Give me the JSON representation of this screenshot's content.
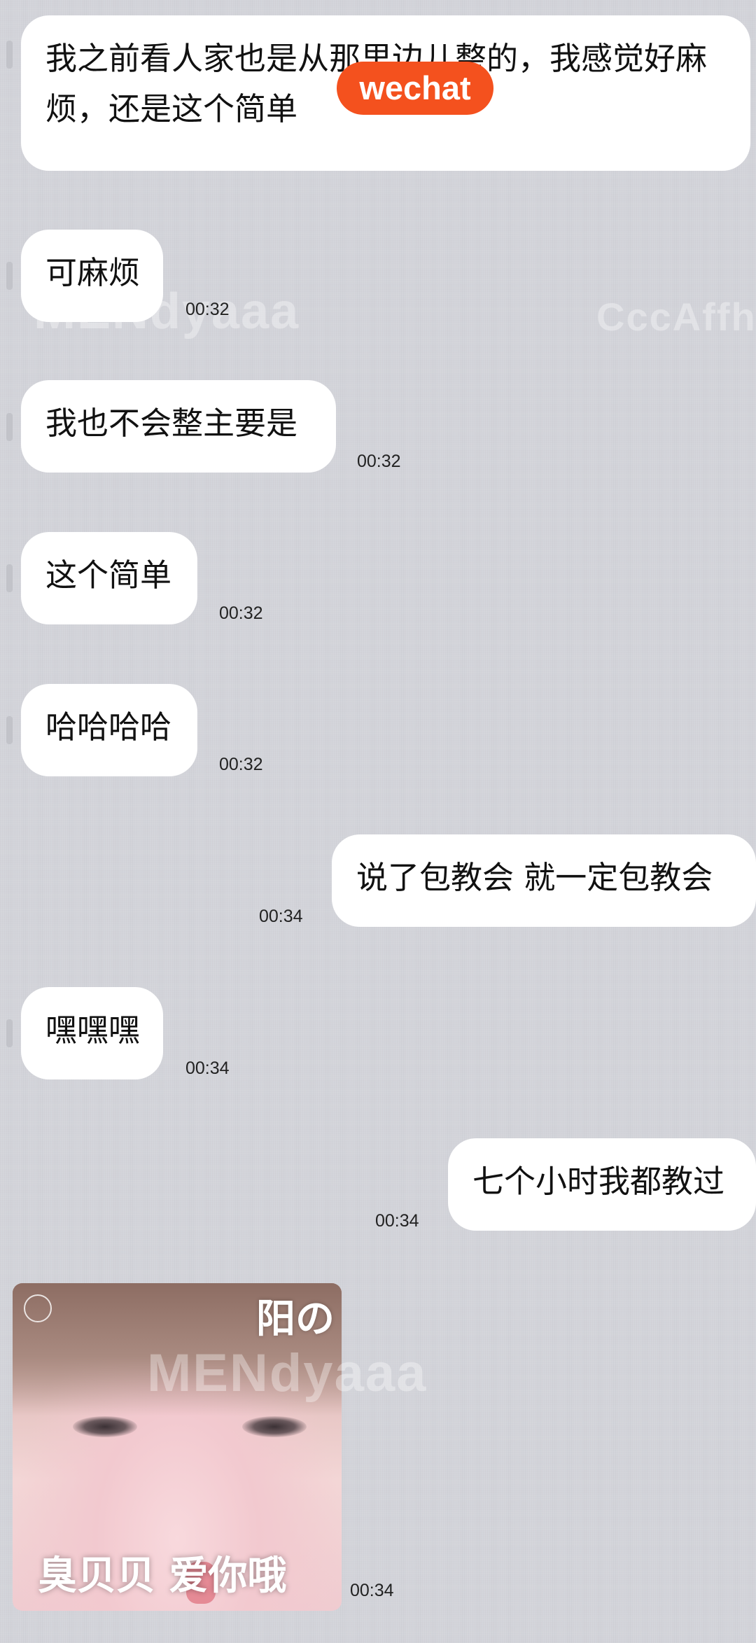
{
  "badge": {
    "text": "wechat",
    "color": "#f4511e"
  },
  "watermarks": [
    "MENdyaaa",
    "CccAffhg",
    "MENdyaaa"
  ],
  "messages": [
    {
      "side": "received",
      "text": "我之前看人家也是从那里边儿整的，我感觉好麻烦，还是这个简单",
      "time": ""
    },
    {
      "side": "received",
      "text": "可麻烦",
      "time": "00:32"
    },
    {
      "side": "received",
      "text": "我也不会整主要是",
      "time": "00:32"
    },
    {
      "side": "received",
      "text": "这个简单",
      "time": "00:32"
    },
    {
      "side": "received",
      "text": "哈哈哈哈",
      "time": "00:32"
    },
    {
      "side": "sent",
      "text": "说了包教会  就一定包教会",
      "time": "00:34"
    },
    {
      "side": "received",
      "text": "嘿嘿嘿",
      "time": "00:34"
    },
    {
      "side": "sent",
      "text": "七个小时我都教过",
      "time": "00:34"
    }
  ],
  "sticker": {
    "title": "阳の",
    "caption": "臭贝贝  爱你哦",
    "time": "00:34"
  },
  "colors": {
    "background": "#d3d4da",
    "bubble": "#ffffff",
    "text": "#111111"
  }
}
